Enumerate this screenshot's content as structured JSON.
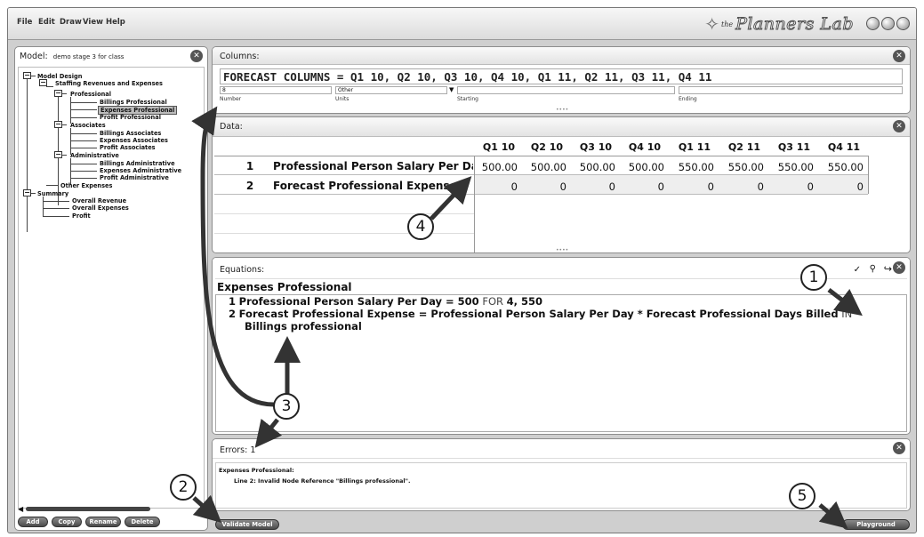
{
  "menubar": {
    "items": [
      "File",
      "Edit",
      "Draw",
      "View",
      "Help"
    ],
    "brand_the": "the",
    "brand_name": "Planners Lab"
  },
  "model_panel": {
    "title_label": "Model:",
    "model_name": "demo stage 3 for class",
    "tree": [
      {
        "label": "Model Design",
        "selected": false
      },
      {
        "label": "Staffing Revenues and Expenses",
        "selected": false
      },
      {
        "label": "Professional",
        "selected": false
      },
      {
        "label": "Billings Professional",
        "selected": false
      },
      {
        "label": "Expenses Professional",
        "selected": true
      },
      {
        "label": "Profit Professional",
        "selected": false
      },
      {
        "label": "Associates",
        "selected": false
      },
      {
        "label": "Billings Associates",
        "selected": false
      },
      {
        "label": "Expenses Associates",
        "selected": false
      },
      {
        "label": "Profit Associates",
        "selected": false
      },
      {
        "label": "Administrative",
        "selected": false
      },
      {
        "label": "Billings Administrative",
        "selected": false
      },
      {
        "label": "Expenses Administrative",
        "selected": false
      },
      {
        "label": "Profit Administrative",
        "selected": false
      },
      {
        "label": "Other Expenses",
        "selected": false
      },
      {
        "label": "Summary",
        "selected": false
      },
      {
        "label": "Overall Revenue",
        "selected": false
      },
      {
        "label": "Overall Expenses",
        "selected": false
      },
      {
        "label": "Profit",
        "selected": false
      }
    ],
    "buttons": {
      "add": "Add",
      "copy": "Copy",
      "rename": "Rename",
      "delete": "Delete"
    }
  },
  "columns_panel": {
    "title": "Columns:",
    "formula": "FORECAST COLUMNS = Q1 10, Q2 10, Q3 10, Q4 10, Q1 11, Q2 11, Q3 11, Q4 11",
    "number_value": "8",
    "units_value": "Other",
    "labels": {
      "number": "Number",
      "units": "Units",
      "starting": "Starting",
      "ending": "Ending"
    }
  },
  "data_panel": {
    "title": "Data:",
    "columns": [
      "Q1 10",
      "Q2 10",
      "Q3 10",
      "Q4 10",
      "Q1 11",
      "Q2 11",
      "Q3 11",
      "Q4 11"
    ],
    "rows": [
      {
        "num": "1",
        "label": "Professional Person Salary Per Day",
        "values": [
          "500.00",
          "500.00",
          "500.00",
          "500.00",
          "550.00",
          "550.00",
          "550.00",
          "550.00"
        ]
      },
      {
        "num": "2",
        "label": "Forecast Professional Expense",
        "values": [
          "0",
          "0",
          "0",
          "0",
          "0",
          "0",
          "0",
          "0"
        ]
      }
    ]
  },
  "equations_panel": {
    "title": "Equations:",
    "node_name": "Expenses Professional",
    "line1": {
      "num": "1",
      "name": "Professional Person Salary Per Day",
      "eq": " = ",
      "value": "500",
      "kw": " FOR ",
      "rest": "4, 550"
    },
    "line2": {
      "num": "2",
      "name": "Forecast Professional Expense",
      "eq": " = ",
      "expr": "Professional Person Salary Per Day * Forecast Professional Days Billed",
      "kw": " IN",
      "ref": "Billings professional"
    }
  },
  "errors_panel": {
    "title": "Errors:",
    "count": "1",
    "node": "Expenses Professional:",
    "message": "Line 2:  Invalid Node Reference \"Billings professional\"."
  },
  "buttons": {
    "validate": "Validate Model",
    "playground": "Playground"
  },
  "callouts": [
    "1",
    "2",
    "3",
    "4",
    "5"
  ]
}
